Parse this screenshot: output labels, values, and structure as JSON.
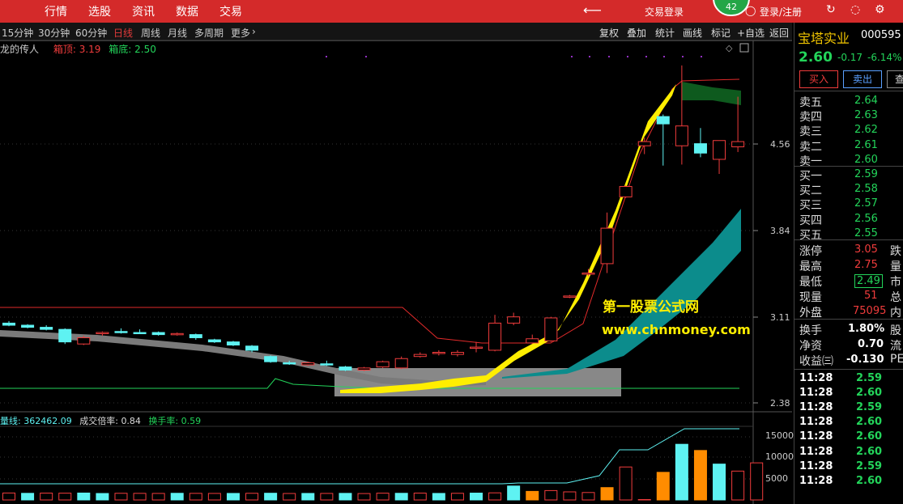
{
  "topnav": {
    "items": [
      "行情",
      "选股",
      "资讯",
      "数据",
      "交易"
    ],
    "back_icon": "arrow-left-icon",
    "trade_login": "交易登录",
    "badge": "42",
    "login": "登录/注册"
  },
  "toolbar": {
    "periods": [
      "15分钟",
      "30分钟",
      "60分钟",
      "日线",
      "周线",
      "月线",
      "多周期",
      "更多"
    ],
    "active": "日线",
    "right": [
      "复权",
      "叠加",
      "统计",
      "画线",
      "标记",
      "+自选",
      "返回"
    ]
  },
  "chart": {
    "indicator_name": "龙的传人",
    "box_top_label": "箱顶:",
    "box_top": "3.19",
    "box_bottom_label": "箱底:",
    "box_bottom": "2.50",
    "yticks": [
      "4.56",
      "3.84",
      "3.11",
      "2.38"
    ],
    "watermark1": "第一股票公式网",
    "watermark2": "www.chnmoney.com",
    "vol_label": "量线:",
    "vol_value": "362462.09",
    "ratio_label": "成交倍率:",
    "ratio_value": "0.84",
    "turnover_label": "换手率:",
    "turnover_value": "0.59",
    "vol_yticks": [
      "15000",
      "10000",
      "5000"
    ],
    "colors": {
      "up": "#f03c3c",
      "down": "#5ef2f2",
      "yellow": "#ffee00",
      "teal": "#0c8c8c",
      "box": "#888888"
    }
  },
  "chart_data": {
    "type": "candlestick",
    "ylim": [
      2.2,
      5.55
    ],
    "ohlc": [
      {
        "o": 2.98,
        "h": 3.0,
        "l": 2.95,
        "c": 2.96
      },
      {
        "o": 2.96,
        "h": 2.97,
        "l": 2.93,
        "c": 2.94
      },
      {
        "o": 2.94,
        "h": 2.96,
        "l": 2.91,
        "c": 2.92
      },
      {
        "o": 2.92,
        "h": 2.93,
        "l": 2.78,
        "c": 2.8
      },
      {
        "o": 2.78,
        "h": 2.86,
        "l": 2.77,
        "c": 2.84
      },
      {
        "o": 2.88,
        "h": 2.9,
        "l": 2.86,
        "c": 2.89
      },
      {
        "o": 2.9,
        "h": 2.93,
        "l": 2.88,
        "c": 2.89
      },
      {
        "o": 2.89,
        "h": 2.92,
        "l": 2.88,
        "c": 2.88
      },
      {
        "o": 2.89,
        "h": 2.9,
        "l": 2.86,
        "c": 2.87
      },
      {
        "o": 2.88,
        "h": 2.89,
        "l": 2.86,
        "c": 2.88
      },
      {
        "o": 2.87,
        "h": 2.88,
        "l": 2.82,
        "c": 2.84
      },
      {
        "o": 2.82,
        "h": 2.83,
        "l": 2.79,
        "c": 2.8
      },
      {
        "o": 2.8,
        "h": 2.81,
        "l": 2.76,
        "c": 2.77
      },
      {
        "o": 2.76,
        "h": 2.77,
        "l": 2.7,
        "c": 2.72
      },
      {
        "o": 2.66,
        "h": 2.67,
        "l": 2.6,
        "c": 2.61
      },
      {
        "o": 2.6,
        "h": 2.62,
        "l": 2.58,
        "c": 2.59
      },
      {
        "o": 2.58,
        "h": 2.61,
        "l": 2.57,
        "c": 2.6
      },
      {
        "o": 2.59,
        "h": 2.62,
        "l": 2.57,
        "c": 2.58
      },
      {
        "o": 2.56,
        "h": 2.57,
        "l": 2.52,
        "c": 2.53
      },
      {
        "o": 2.53,
        "h": 2.56,
        "l": 2.52,
        "c": 2.55
      },
      {
        "o": 2.56,
        "h": 2.62,
        "l": 2.55,
        "c": 2.61
      },
      {
        "o": 2.55,
        "h": 2.66,
        "l": 2.54,
        "c": 2.64
      },
      {
        "o": 2.66,
        "h": 2.7,
        "l": 2.65,
        "c": 2.68
      },
      {
        "o": 2.69,
        "h": 2.72,
        "l": 2.67,
        "c": 2.7
      },
      {
        "o": 2.68,
        "h": 2.72,
        "l": 2.66,
        "c": 2.7
      },
      {
        "o": 2.74,
        "h": 2.8,
        "l": 2.7,
        "c": 2.75
      },
      {
        "o": 2.72,
        "h": 3.06,
        "l": 2.71,
        "c": 2.98
      },
      {
        "o": 2.98,
        "h": 3.08,
        "l": 2.96,
        "c": 3.04
      },
      {
        "o": 2.79,
        "h": 2.87,
        "l": 2.78,
        "c": 2.83
      },
      {
        "o": 2.81,
        "h": 3.04,
        "l": 2.8,
        "c": 3.03
      },
      {
        "o": 3.24,
        "h": 3.25,
        "l": 3.22,
        "c": 3.24
      },
      {
        "o": 3.45,
        "h": 3.5,
        "l": 3.43,
        "c": 3.46
      },
      {
        "o": 3.55,
        "h": 4.04,
        "l": 3.46,
        "c": 3.89
      },
      {
        "o": 4.19,
        "h": 4.3,
        "l": 4.18,
        "c": 4.29
      },
      {
        "o": 4.68,
        "h": 4.76,
        "l": 4.6,
        "c": 4.72
      },
      {
        "o": 4.96,
        "h": 4.98,
        "l": 4.49,
        "c": 4.89
      },
      {
        "o": 4.68,
        "h": 5.45,
        "l": 4.5,
        "c": 4.87
      },
      {
        "o": 4.7,
        "h": 4.85,
        "l": 4.57,
        "c": 4.61
      },
      {
        "o": 4.55,
        "h": 4.68,
        "l": 4.41,
        "c": 4.73
      },
      {
        "o": 4.67,
        "h": 5.15,
        "l": 4.62,
        "c": 4.72
      }
    ],
    "volume": [
      650,
      550,
      620,
      600,
      640,
      500,
      560,
      540,
      520,
      560,
      540,
      520,
      520,
      560,
      580,
      500,
      520,
      520,
      540,
      480,
      600,
      560,
      620,
      520,
      560,
      620,
      700,
      2800,
      1150,
      1400,
      1000,
      800,
      6500,
      11500,
      3600,
      10200,
      17000,
      15500,
      12200,
      10500,
      12500
    ],
    "volume_up": [
      1,
      0,
      1,
      1,
      0,
      0,
      1,
      1,
      1,
      0,
      1,
      1,
      0,
      1,
      0,
      1,
      0,
      1,
      0,
      1,
      1,
      0,
      1,
      0,
      1,
      0,
      1,
      0,
      1,
      1,
      1,
      1,
      1,
      1,
      1,
      1,
      0,
      1,
      0,
      1,
      1
    ],
    "vol_ylim": [
      3500,
      19000
    ]
  },
  "quote": {
    "name": "宝塔实业",
    "code": "000595",
    "price": "2.60",
    "change": "-0.17",
    "change_pct": "-6.14%",
    "buy": "买入",
    "sell": "卖出",
    "more": "查",
    "asks": [
      {
        "k": "卖五",
        "v": "2.64"
      },
      {
        "k": "卖四",
        "v": "2.63"
      },
      {
        "k": "卖三",
        "v": "2.62"
      },
      {
        "k": "卖二",
        "v": "2.61"
      },
      {
        "k": "卖一",
        "v": "2.60"
      }
    ],
    "bids": [
      {
        "k": "买一",
        "v": "2.59"
      },
      {
        "k": "买二",
        "v": "2.58"
      },
      {
        "k": "买三",
        "v": "2.57"
      },
      {
        "k": "买四",
        "v": "2.56"
      },
      {
        "k": "买五",
        "v": "2.55"
      }
    ],
    "stats": [
      {
        "k": "涨停",
        "v": "3.05",
        "x": "跌",
        "c": "rd"
      },
      {
        "k": "最高",
        "v": "2.75",
        "x": "量",
        "c": "rd"
      },
      {
        "k": "最低",
        "v": "2.49",
        "x": "市",
        "c": "g"
      },
      {
        "k": "现量",
        "v": "51",
        "x": "总",
        "c": "rd"
      },
      {
        "k": "外盘",
        "v": "75095",
        "x": "内",
        "c": "rd"
      }
    ],
    "stats2": [
      {
        "k": "换手",
        "v": "1.80%",
        "x": "股",
        "c": "w"
      },
      {
        "k": "净资",
        "v": "0.70",
        "x": "流",
        "c": "w"
      },
      {
        "k": "收益㈢",
        "v": "-0.130",
        "x": "PE",
        "c": "w"
      }
    ],
    "ticks": [
      {
        "t": "11:28",
        "p": "2.59"
      },
      {
        "t": "11:28",
        "p": "2.60"
      },
      {
        "t": "11:28",
        "p": "2.59"
      },
      {
        "t": "11:28",
        "p": "2.60"
      },
      {
        "t": "11:28",
        "p": "2.60"
      },
      {
        "t": "11:28",
        "p": "2.60"
      },
      {
        "t": "11:28",
        "p": "2.59"
      },
      {
        "t": "11:28",
        "p": "2.60"
      }
    ]
  }
}
